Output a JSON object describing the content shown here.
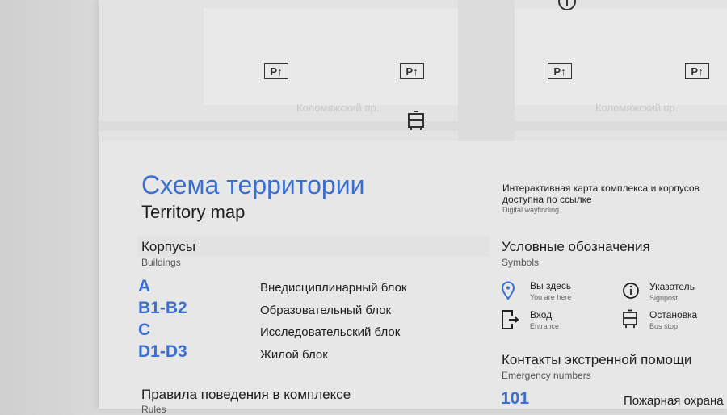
{
  "map": {
    "street_labels": [
      "Коломяжский пр.",
      "Коломяжский пр."
    ],
    "parking_label": "P↑"
  },
  "title": {
    "ru": "Схема территории",
    "en": "Territory map"
  },
  "digital": {
    "ru": "Интерактивная карта комплекса и корпусов доступна по ссылке",
    "en": "Digital wayfinding"
  },
  "buildings": {
    "heading": "Корпусы",
    "sub": "Buildings",
    "items": [
      {
        "code": "A",
        "name": "Внедисциплинарный блок"
      },
      {
        "code": "B1-B2",
        "name": "Образовательный блок"
      },
      {
        "code": "C",
        "name": "Исследовательский блок"
      },
      {
        "code": "D1-D3",
        "name": "Жилой блок"
      }
    ]
  },
  "rules": {
    "heading": "Правила поведения в комплексе",
    "sub": "Rules"
  },
  "symbols": {
    "heading": "Условные обозначения",
    "sub": "Symbols",
    "items": [
      {
        "ru": "Вы здесь",
        "en": "You are here",
        "icon": "location-pin-icon"
      },
      {
        "ru": "Указатель",
        "en": "Signpost",
        "icon": "info-icon"
      },
      {
        "ru": "Вход",
        "en": "Entrance",
        "icon": "entrance-icon"
      },
      {
        "ru": "Остановка",
        "en": "Bus stop",
        "icon": "bus-icon"
      }
    ]
  },
  "emergency": {
    "heading": "Контакты экстренной помощи",
    "sub": "Emergency numbers",
    "number": "101",
    "service": "Пожарная охрана"
  },
  "colors": {
    "accent": "#3a6fd0"
  }
}
